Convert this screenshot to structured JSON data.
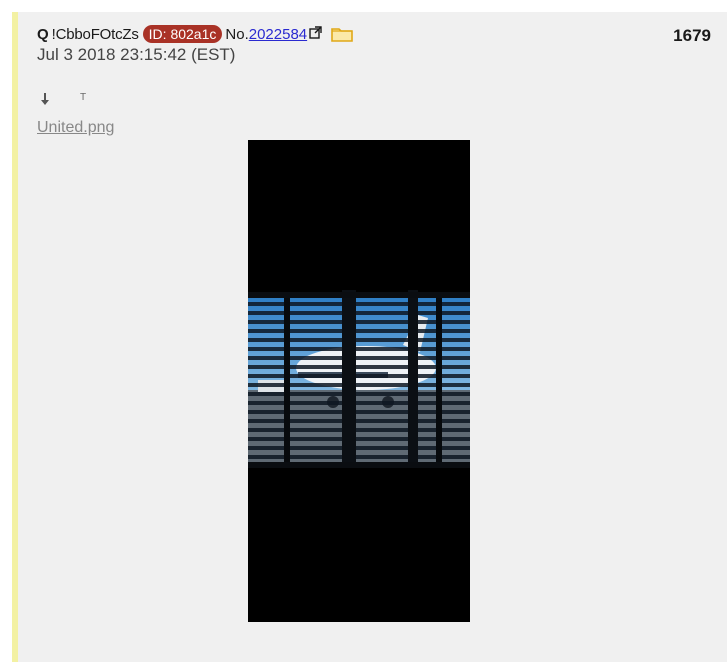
{
  "post": {
    "author": "Q",
    "tripcode": "!CbboFOtcZs",
    "id_badge": "ID: 802a1c",
    "post_prefix": "No.",
    "post_number_link": "2022584",
    "count": "1679",
    "timestamp": "Jul 3 2018 23:15:42 (EST)",
    "toolbar": {
      "text_icon_glyph": "T"
    },
    "attachment": {
      "filename": "United.png"
    }
  },
  "colors": {
    "post_background": "#f0f0f0",
    "accent_bar": "#f3f1a3",
    "id_badge": "#a93226",
    "link": "#2a2ad0",
    "folder": "#e0a817"
  },
  "icons": {
    "external_link": "external-link-icon",
    "folder": "folder-icon",
    "download": "download-icon",
    "text": "text-icon"
  }
}
